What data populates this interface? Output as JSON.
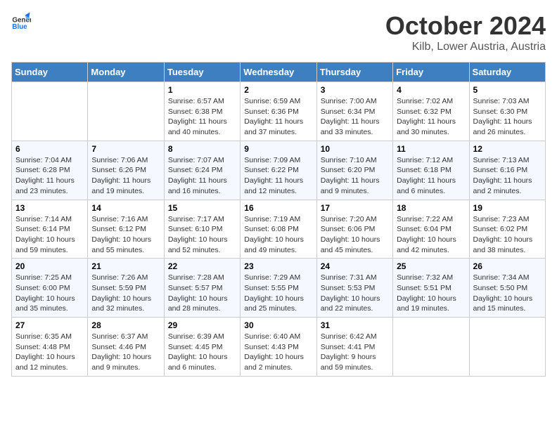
{
  "logo": {
    "general": "General",
    "blue": "Blue"
  },
  "title": "October 2024",
  "location": "Kilb, Lower Austria, Austria",
  "days_of_week": [
    "Sunday",
    "Monday",
    "Tuesday",
    "Wednesday",
    "Thursday",
    "Friday",
    "Saturday"
  ],
  "weeks": [
    [
      {
        "day": null
      },
      {
        "day": null
      },
      {
        "day": "1",
        "sunrise": "Sunrise: 6:57 AM",
        "sunset": "Sunset: 6:38 PM",
        "daylight": "Daylight: 11 hours and 40 minutes."
      },
      {
        "day": "2",
        "sunrise": "Sunrise: 6:59 AM",
        "sunset": "Sunset: 6:36 PM",
        "daylight": "Daylight: 11 hours and 37 minutes."
      },
      {
        "day": "3",
        "sunrise": "Sunrise: 7:00 AM",
        "sunset": "Sunset: 6:34 PM",
        "daylight": "Daylight: 11 hours and 33 minutes."
      },
      {
        "day": "4",
        "sunrise": "Sunrise: 7:02 AM",
        "sunset": "Sunset: 6:32 PM",
        "daylight": "Daylight: 11 hours and 30 minutes."
      },
      {
        "day": "5",
        "sunrise": "Sunrise: 7:03 AM",
        "sunset": "Sunset: 6:30 PM",
        "daylight": "Daylight: 11 hours and 26 minutes."
      }
    ],
    [
      {
        "day": "6",
        "sunrise": "Sunrise: 7:04 AM",
        "sunset": "Sunset: 6:28 PM",
        "daylight": "Daylight: 11 hours and 23 minutes."
      },
      {
        "day": "7",
        "sunrise": "Sunrise: 7:06 AM",
        "sunset": "Sunset: 6:26 PM",
        "daylight": "Daylight: 11 hours and 19 minutes."
      },
      {
        "day": "8",
        "sunrise": "Sunrise: 7:07 AM",
        "sunset": "Sunset: 6:24 PM",
        "daylight": "Daylight: 11 hours and 16 minutes."
      },
      {
        "day": "9",
        "sunrise": "Sunrise: 7:09 AM",
        "sunset": "Sunset: 6:22 PM",
        "daylight": "Daylight: 11 hours and 12 minutes."
      },
      {
        "day": "10",
        "sunrise": "Sunrise: 7:10 AM",
        "sunset": "Sunset: 6:20 PM",
        "daylight": "Daylight: 11 hours and 9 minutes."
      },
      {
        "day": "11",
        "sunrise": "Sunrise: 7:12 AM",
        "sunset": "Sunset: 6:18 PM",
        "daylight": "Daylight: 11 hours and 6 minutes."
      },
      {
        "day": "12",
        "sunrise": "Sunrise: 7:13 AM",
        "sunset": "Sunset: 6:16 PM",
        "daylight": "Daylight: 11 hours and 2 minutes."
      }
    ],
    [
      {
        "day": "13",
        "sunrise": "Sunrise: 7:14 AM",
        "sunset": "Sunset: 6:14 PM",
        "daylight": "Daylight: 10 hours and 59 minutes."
      },
      {
        "day": "14",
        "sunrise": "Sunrise: 7:16 AM",
        "sunset": "Sunset: 6:12 PM",
        "daylight": "Daylight: 10 hours and 55 minutes."
      },
      {
        "day": "15",
        "sunrise": "Sunrise: 7:17 AM",
        "sunset": "Sunset: 6:10 PM",
        "daylight": "Daylight: 10 hours and 52 minutes."
      },
      {
        "day": "16",
        "sunrise": "Sunrise: 7:19 AM",
        "sunset": "Sunset: 6:08 PM",
        "daylight": "Daylight: 10 hours and 49 minutes."
      },
      {
        "day": "17",
        "sunrise": "Sunrise: 7:20 AM",
        "sunset": "Sunset: 6:06 PM",
        "daylight": "Daylight: 10 hours and 45 minutes."
      },
      {
        "day": "18",
        "sunrise": "Sunrise: 7:22 AM",
        "sunset": "Sunset: 6:04 PM",
        "daylight": "Daylight: 10 hours and 42 minutes."
      },
      {
        "day": "19",
        "sunrise": "Sunrise: 7:23 AM",
        "sunset": "Sunset: 6:02 PM",
        "daylight": "Daylight: 10 hours and 38 minutes."
      }
    ],
    [
      {
        "day": "20",
        "sunrise": "Sunrise: 7:25 AM",
        "sunset": "Sunset: 6:00 PM",
        "daylight": "Daylight: 10 hours and 35 minutes."
      },
      {
        "day": "21",
        "sunrise": "Sunrise: 7:26 AM",
        "sunset": "Sunset: 5:59 PM",
        "daylight": "Daylight: 10 hours and 32 minutes."
      },
      {
        "day": "22",
        "sunrise": "Sunrise: 7:28 AM",
        "sunset": "Sunset: 5:57 PM",
        "daylight": "Daylight: 10 hours and 28 minutes."
      },
      {
        "day": "23",
        "sunrise": "Sunrise: 7:29 AM",
        "sunset": "Sunset: 5:55 PM",
        "daylight": "Daylight: 10 hours and 25 minutes."
      },
      {
        "day": "24",
        "sunrise": "Sunrise: 7:31 AM",
        "sunset": "Sunset: 5:53 PM",
        "daylight": "Daylight: 10 hours and 22 minutes."
      },
      {
        "day": "25",
        "sunrise": "Sunrise: 7:32 AM",
        "sunset": "Sunset: 5:51 PM",
        "daylight": "Daylight: 10 hours and 19 minutes."
      },
      {
        "day": "26",
        "sunrise": "Sunrise: 7:34 AM",
        "sunset": "Sunset: 5:50 PM",
        "daylight": "Daylight: 10 hours and 15 minutes."
      }
    ],
    [
      {
        "day": "27",
        "sunrise": "Sunrise: 6:35 AM",
        "sunset": "Sunset: 4:48 PM",
        "daylight": "Daylight: 10 hours and 12 minutes."
      },
      {
        "day": "28",
        "sunrise": "Sunrise: 6:37 AM",
        "sunset": "Sunset: 4:46 PM",
        "daylight": "Daylight: 10 hours and 9 minutes."
      },
      {
        "day": "29",
        "sunrise": "Sunrise: 6:39 AM",
        "sunset": "Sunset: 4:45 PM",
        "daylight": "Daylight: 10 hours and 6 minutes."
      },
      {
        "day": "30",
        "sunrise": "Sunrise: 6:40 AM",
        "sunset": "Sunset: 4:43 PM",
        "daylight": "Daylight: 10 hours and 2 minutes."
      },
      {
        "day": "31",
        "sunrise": "Sunrise: 6:42 AM",
        "sunset": "Sunset: 4:41 PM",
        "daylight": "Daylight: 9 hours and 59 minutes."
      },
      {
        "day": null
      },
      {
        "day": null
      }
    ]
  ]
}
